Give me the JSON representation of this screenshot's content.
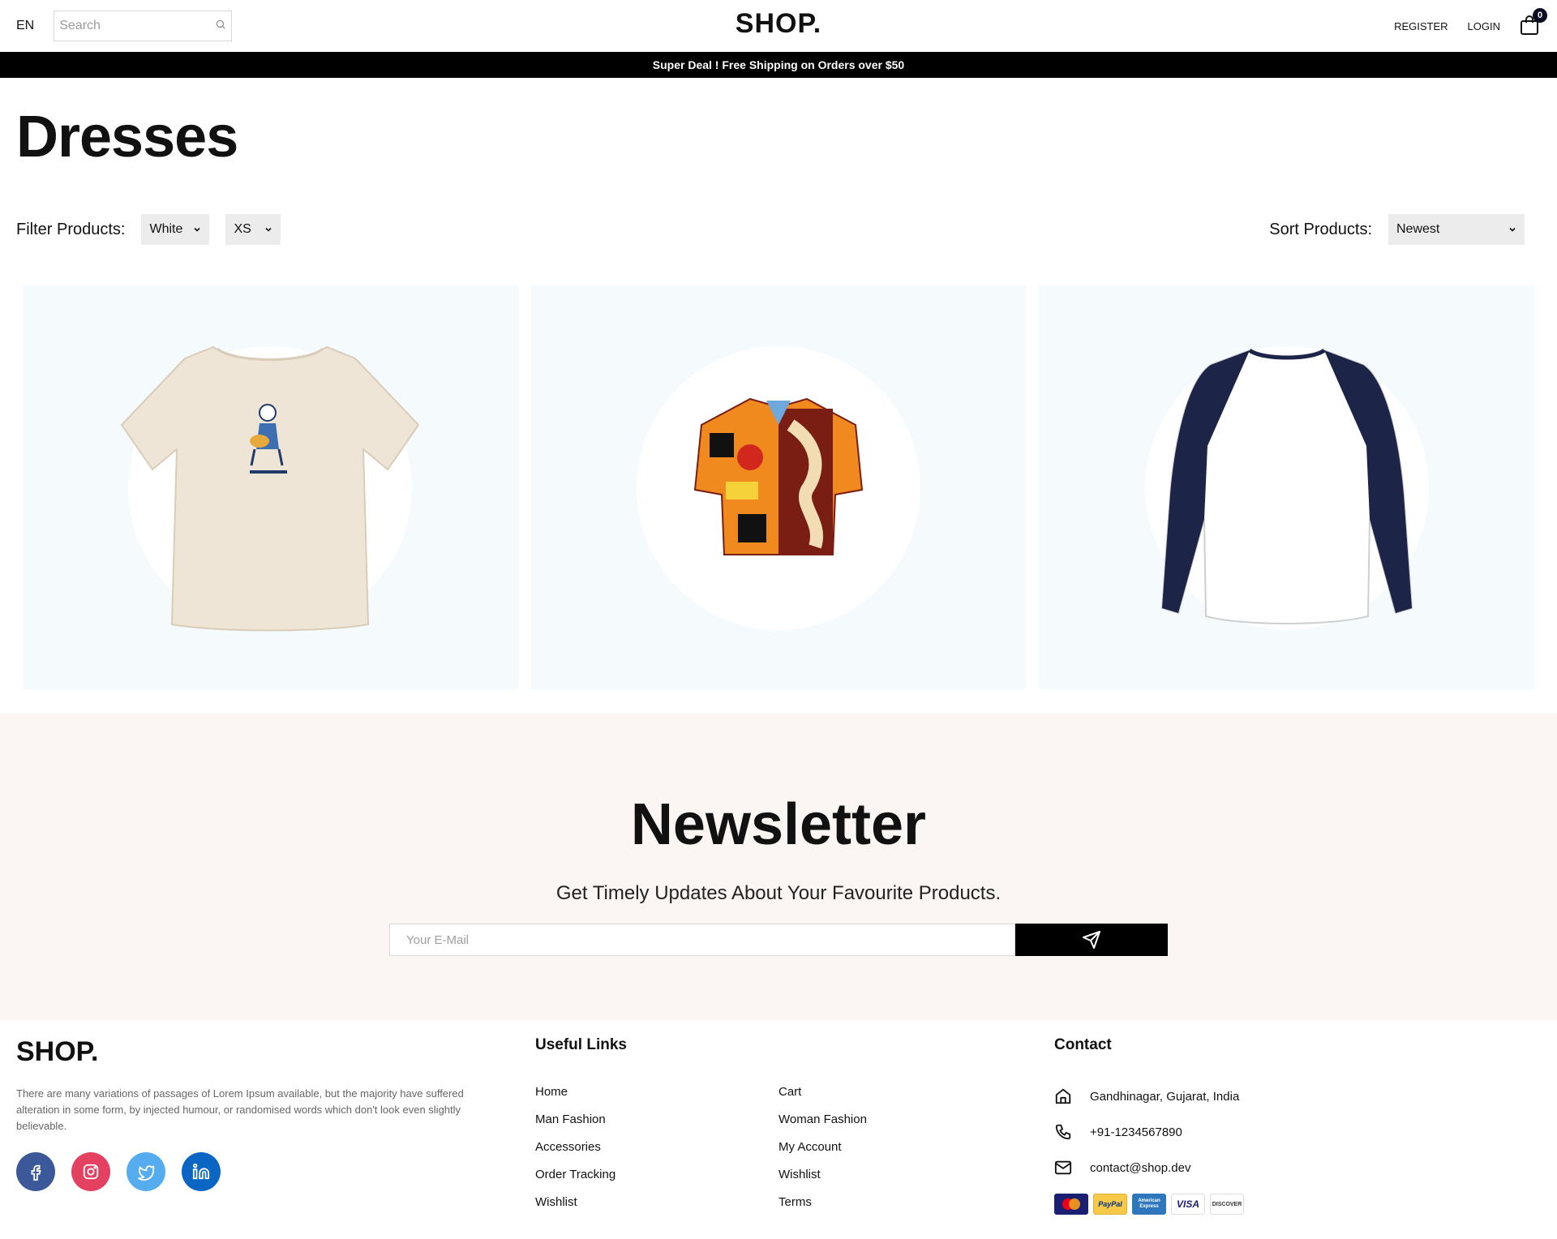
{
  "navbar": {
    "language": "EN",
    "search_placeholder": "Search",
    "logo": "SHOP.",
    "register": "REGISTER",
    "login": "LOGIN",
    "cart_count": "0"
  },
  "announcement": "Super Deal ! Free Shipping on Orders over $50",
  "page_title": "Dresses",
  "filters": {
    "filter_label": "Filter Products:",
    "color_value": "White",
    "size_value": "XS",
    "sort_label": "Sort Products:",
    "sort_value": "Newest"
  },
  "products": [
    {
      "name": "cream-tshirt"
    },
    {
      "name": "printed-shirt"
    },
    {
      "name": "raglan-longsleeve"
    }
  ],
  "newsletter": {
    "title": "Newsletter",
    "subtitle": "Get Timely Updates About Your Favourite Products.",
    "email_placeholder": "Your E-Mail"
  },
  "footer": {
    "logo": "SHOP.",
    "description": "There are many variations of passages of Lorem Ipsum available, but the majority have suffered alteration in some form, by injected humour, or randomised words which don't look even slightly believable.",
    "useful_links_title": "Useful Links",
    "links_col1": [
      "Home",
      "Man Fashion",
      "Accessories",
      "Order Tracking",
      "Wishlist"
    ],
    "links_col2": [
      "Cart",
      "Woman Fashion",
      "My Account",
      "Wishlist",
      "Terms"
    ],
    "contact_title": "Contact",
    "address": "Gandhinagar, Gujarat, India",
    "phone": "+91-1234567890",
    "email": "contact@shop.dev",
    "payment_methods": [
      "MasterCard",
      "PayPal",
      "American Express",
      "VISA",
      "DISCOVER"
    ]
  },
  "colors": {
    "announcement_bg": "#000000",
    "card_bg": "#f5fbfd",
    "newsletter_bg": "#fbf5f3",
    "facebook": "#3b5999",
    "instagram": "#e4405f",
    "twitter": "#55acee",
    "linkedin": "#0a66c2"
  }
}
